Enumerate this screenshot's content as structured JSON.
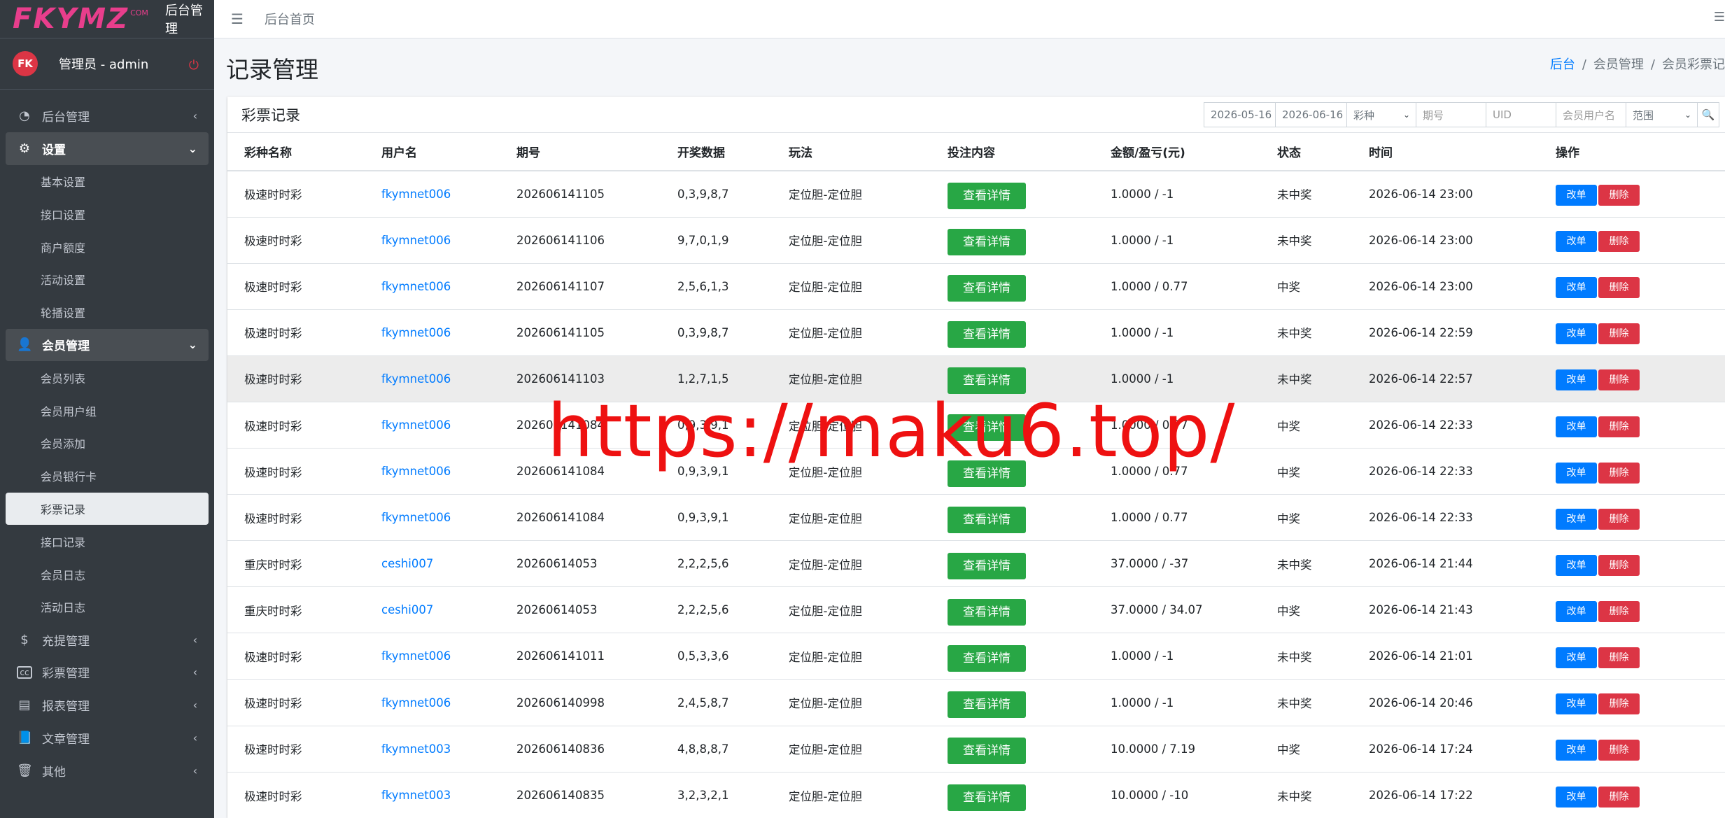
{
  "brand": {
    "logo": "FKYMZ",
    "logo_small": "COM",
    "title": "后台管理"
  },
  "user": {
    "avatar_text": "FK",
    "name": "管理员 - admin"
  },
  "sidebar": {
    "items": [
      {
        "label": "后台管理",
        "icon": "dashboard-icon",
        "state": "collapsed"
      },
      {
        "label": "设置",
        "icon": "gear-icon",
        "state": "open",
        "children": [
          "基本设置",
          "接口设置",
          "商户额度",
          "活动设置",
          "轮播设置"
        ]
      },
      {
        "label": "会员管理",
        "icon": "user-icon",
        "state": "open",
        "children": [
          "会员列表",
          "会员用户组",
          "会员添加",
          "会员银行卡",
          "彩票记录",
          "接口记录",
          "会员日志",
          "活动日志"
        ],
        "active_child": "彩票记录"
      },
      {
        "label": "充提管理",
        "icon": "dollar-icon",
        "state": "collapsed"
      },
      {
        "label": "彩票管理",
        "icon": "cc-icon",
        "state": "collapsed"
      },
      {
        "label": "报表管理",
        "icon": "file-icon",
        "state": "collapsed"
      },
      {
        "label": "文章管理",
        "icon": "book-icon",
        "state": "collapsed"
      },
      {
        "label": "其他",
        "icon": "trash-icon",
        "state": "collapsed"
      }
    ]
  },
  "navbar": {
    "home": "后台首页"
  },
  "page": {
    "title": "记录管理"
  },
  "breadcrumb": {
    "home": "后台",
    "parent": "会员管理",
    "current": "会员彩票记"
  },
  "card": {
    "title": "彩票记录"
  },
  "filters": {
    "date_start": "2026-05-16",
    "date_end": "2026-06-16",
    "lottery_select": "彩种",
    "issue_placeholder": "期号",
    "uid_placeholder": "UID",
    "username_placeholder": "会员用户名",
    "range_select": "范围"
  },
  "table": {
    "headers": [
      "彩种名称",
      "用户名",
      "期号",
      "开奖数据",
      "玩法",
      "投注内容",
      "金额/盈亏(元)",
      "状态",
      "时间",
      "操作"
    ],
    "detail_label": "查看详情",
    "edit_label": "改单",
    "delete_label": "删除",
    "rows": [
      [
        "极速时时彩",
        "fkymnet006",
        "202606141105",
        "0,3,9,8,7",
        "定位胆-定位胆",
        "1.0000 / -1",
        "未中奖",
        "2026-06-14 23:00"
      ],
      [
        "极速时时彩",
        "fkymnet006",
        "202606141106",
        "9,7,0,1,9",
        "定位胆-定位胆",
        "1.0000 / -1",
        "未中奖",
        "2026-06-14 23:00"
      ],
      [
        "极速时时彩",
        "fkymnet006",
        "202606141107",
        "2,5,6,1,3",
        "定位胆-定位胆",
        "1.0000 / 0.77",
        "中奖",
        "2026-06-14 23:00"
      ],
      [
        "极速时时彩",
        "fkymnet006",
        "202606141105",
        "0,3,9,8,7",
        "定位胆-定位胆",
        "1.0000 / -1",
        "未中奖",
        "2026-06-14 22:59"
      ],
      [
        "极速时时彩",
        "fkymnet006",
        "202606141103",
        "1,2,7,1,5",
        "定位胆-定位胆",
        "1.0000 / -1",
        "未中奖",
        "2026-06-14 22:57"
      ],
      [
        "极速时时彩",
        "fkymnet006",
        "202606141084",
        "0,9,3,9,1",
        "定位胆-定位胆",
        "1.0000 / 0.77",
        "中奖",
        "2026-06-14 22:33"
      ],
      [
        "极速时时彩",
        "fkymnet006",
        "202606141084",
        "0,9,3,9,1",
        "定位胆-定位胆",
        "1.0000 / 0.77",
        "中奖",
        "2026-06-14 22:33"
      ],
      [
        "极速时时彩",
        "fkymnet006",
        "202606141084",
        "0,9,3,9,1",
        "定位胆-定位胆",
        "1.0000 / 0.77",
        "中奖",
        "2026-06-14 22:33"
      ],
      [
        "重庆时时彩",
        "ceshi007",
        "20260614053",
        "2,2,2,5,6",
        "定位胆-定位胆",
        "37.0000 / -37",
        "未中奖",
        "2026-06-14 21:44"
      ],
      [
        "重庆时时彩",
        "ceshi007",
        "20260614053",
        "2,2,2,5,6",
        "定位胆-定位胆",
        "37.0000 / 34.07",
        "中奖",
        "2026-06-14 21:43"
      ],
      [
        "极速时时彩",
        "fkymnet006",
        "202606141011",
        "0,5,3,3,6",
        "定位胆-定位胆",
        "1.0000 / -1",
        "未中奖",
        "2026-06-14 21:01"
      ],
      [
        "极速时时彩",
        "fkymnet006",
        "202606140998",
        "2,4,5,8,7",
        "定位胆-定位胆",
        "1.0000 / -1",
        "未中奖",
        "2026-06-14 20:46"
      ],
      [
        "极速时时彩",
        "fkymnet003",
        "202606140836",
        "4,8,8,8,7",
        "定位胆-定位胆",
        "10.0000 / 7.19",
        "中奖",
        "2026-06-14 17:24"
      ],
      [
        "极速时时彩",
        "fkymnet003",
        "202606140835",
        "3,2,3,2,1",
        "定位胆-定位胆",
        "10.0000 / -10",
        "未中奖",
        "2026-06-14 17:22"
      ]
    ],
    "highlighted_row": 4
  },
  "watermark": "https://maku6.top/",
  "colors": {
    "sidebar_bg": "#343a40",
    "primary": "#007bff",
    "success": "#28a745",
    "danger": "#dc3545",
    "logo": "#e83e8c",
    "watermark": "#ee1111"
  }
}
